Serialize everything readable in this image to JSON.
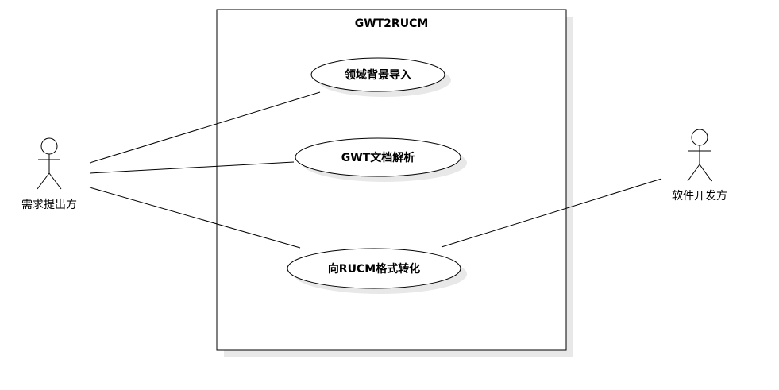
{
  "system": {
    "title": "GWT2RUCM"
  },
  "use_cases": [
    {
      "label": "领域背景导入"
    },
    {
      "label": "GWT文档解析"
    },
    {
      "label": "向RUCM格式转化"
    }
  ],
  "actors": [
    {
      "label": "需求提出方"
    },
    {
      "label": "软件开发方"
    }
  ],
  "colors": {
    "stroke": "#000000",
    "fill": "#ffffff",
    "shadow": "#e8e8e8",
    "text": "#000000"
  }
}
